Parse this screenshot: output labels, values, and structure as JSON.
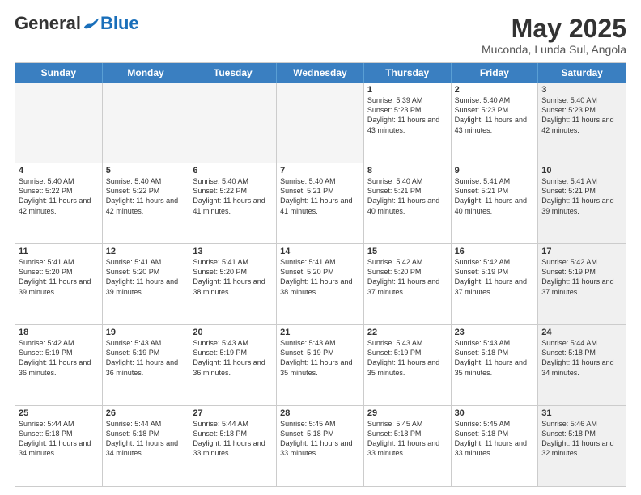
{
  "header": {
    "logo_general": "General",
    "logo_blue": "Blue",
    "month_title": "May 2025",
    "location": "Muconda, Lunda Sul, Angola"
  },
  "weekdays": [
    "Sunday",
    "Monday",
    "Tuesday",
    "Wednesday",
    "Thursday",
    "Friday",
    "Saturday"
  ],
  "rows": [
    [
      {
        "day": "",
        "info": "",
        "empty": true
      },
      {
        "day": "",
        "info": "",
        "empty": true
      },
      {
        "day": "",
        "info": "",
        "empty": true
      },
      {
        "day": "",
        "info": "",
        "empty": true
      },
      {
        "day": "1",
        "info": "Sunrise: 5:39 AM\nSunset: 5:23 PM\nDaylight: 11 hours\nand 43 minutes.",
        "empty": false
      },
      {
        "day": "2",
        "info": "Sunrise: 5:40 AM\nSunset: 5:23 PM\nDaylight: 11 hours\nand 43 minutes.",
        "empty": false
      },
      {
        "day": "3",
        "info": "Sunrise: 5:40 AM\nSunset: 5:23 PM\nDaylight: 11 hours\nand 42 minutes.",
        "empty": false,
        "shaded": true
      }
    ],
    [
      {
        "day": "4",
        "info": "Sunrise: 5:40 AM\nSunset: 5:22 PM\nDaylight: 11 hours\nand 42 minutes.",
        "empty": false
      },
      {
        "day": "5",
        "info": "Sunrise: 5:40 AM\nSunset: 5:22 PM\nDaylight: 11 hours\nand 42 minutes.",
        "empty": false
      },
      {
        "day": "6",
        "info": "Sunrise: 5:40 AM\nSunset: 5:22 PM\nDaylight: 11 hours\nand 41 minutes.",
        "empty": false
      },
      {
        "day": "7",
        "info": "Sunrise: 5:40 AM\nSunset: 5:21 PM\nDaylight: 11 hours\nand 41 minutes.",
        "empty": false
      },
      {
        "day": "8",
        "info": "Sunrise: 5:40 AM\nSunset: 5:21 PM\nDaylight: 11 hours\nand 40 minutes.",
        "empty": false
      },
      {
        "day": "9",
        "info": "Sunrise: 5:41 AM\nSunset: 5:21 PM\nDaylight: 11 hours\nand 40 minutes.",
        "empty": false
      },
      {
        "day": "10",
        "info": "Sunrise: 5:41 AM\nSunset: 5:21 PM\nDaylight: 11 hours\nand 39 minutes.",
        "empty": false,
        "shaded": true
      }
    ],
    [
      {
        "day": "11",
        "info": "Sunrise: 5:41 AM\nSunset: 5:20 PM\nDaylight: 11 hours\nand 39 minutes.",
        "empty": false
      },
      {
        "day": "12",
        "info": "Sunrise: 5:41 AM\nSunset: 5:20 PM\nDaylight: 11 hours\nand 39 minutes.",
        "empty": false
      },
      {
        "day": "13",
        "info": "Sunrise: 5:41 AM\nSunset: 5:20 PM\nDaylight: 11 hours\nand 38 minutes.",
        "empty": false
      },
      {
        "day": "14",
        "info": "Sunrise: 5:41 AM\nSunset: 5:20 PM\nDaylight: 11 hours\nand 38 minutes.",
        "empty": false
      },
      {
        "day": "15",
        "info": "Sunrise: 5:42 AM\nSunset: 5:20 PM\nDaylight: 11 hours\nand 37 minutes.",
        "empty": false
      },
      {
        "day": "16",
        "info": "Sunrise: 5:42 AM\nSunset: 5:19 PM\nDaylight: 11 hours\nand 37 minutes.",
        "empty": false
      },
      {
        "day": "17",
        "info": "Sunrise: 5:42 AM\nSunset: 5:19 PM\nDaylight: 11 hours\nand 37 minutes.",
        "empty": false,
        "shaded": true
      }
    ],
    [
      {
        "day": "18",
        "info": "Sunrise: 5:42 AM\nSunset: 5:19 PM\nDaylight: 11 hours\nand 36 minutes.",
        "empty": false
      },
      {
        "day": "19",
        "info": "Sunrise: 5:43 AM\nSunset: 5:19 PM\nDaylight: 11 hours\nand 36 minutes.",
        "empty": false
      },
      {
        "day": "20",
        "info": "Sunrise: 5:43 AM\nSunset: 5:19 PM\nDaylight: 11 hours\nand 36 minutes.",
        "empty": false
      },
      {
        "day": "21",
        "info": "Sunrise: 5:43 AM\nSunset: 5:19 PM\nDaylight: 11 hours\nand 35 minutes.",
        "empty": false
      },
      {
        "day": "22",
        "info": "Sunrise: 5:43 AM\nSunset: 5:19 PM\nDaylight: 11 hours\nand 35 minutes.",
        "empty": false
      },
      {
        "day": "23",
        "info": "Sunrise: 5:43 AM\nSunset: 5:18 PM\nDaylight: 11 hours\nand 35 minutes.",
        "empty": false
      },
      {
        "day": "24",
        "info": "Sunrise: 5:44 AM\nSunset: 5:18 PM\nDaylight: 11 hours\nand 34 minutes.",
        "empty": false,
        "shaded": true
      }
    ],
    [
      {
        "day": "25",
        "info": "Sunrise: 5:44 AM\nSunset: 5:18 PM\nDaylight: 11 hours\nand 34 minutes.",
        "empty": false
      },
      {
        "day": "26",
        "info": "Sunrise: 5:44 AM\nSunset: 5:18 PM\nDaylight: 11 hours\nand 34 minutes.",
        "empty": false
      },
      {
        "day": "27",
        "info": "Sunrise: 5:44 AM\nSunset: 5:18 PM\nDaylight: 11 hours\nand 33 minutes.",
        "empty": false
      },
      {
        "day": "28",
        "info": "Sunrise: 5:45 AM\nSunset: 5:18 PM\nDaylight: 11 hours\nand 33 minutes.",
        "empty": false
      },
      {
        "day": "29",
        "info": "Sunrise: 5:45 AM\nSunset: 5:18 PM\nDaylight: 11 hours\nand 33 minutes.",
        "empty": false
      },
      {
        "day": "30",
        "info": "Sunrise: 5:45 AM\nSunset: 5:18 PM\nDaylight: 11 hours\nand 33 minutes.",
        "empty": false
      },
      {
        "day": "31",
        "info": "Sunrise: 5:46 AM\nSunset: 5:18 PM\nDaylight: 11 hours\nand 32 minutes.",
        "empty": false,
        "shaded": true
      }
    ]
  ]
}
